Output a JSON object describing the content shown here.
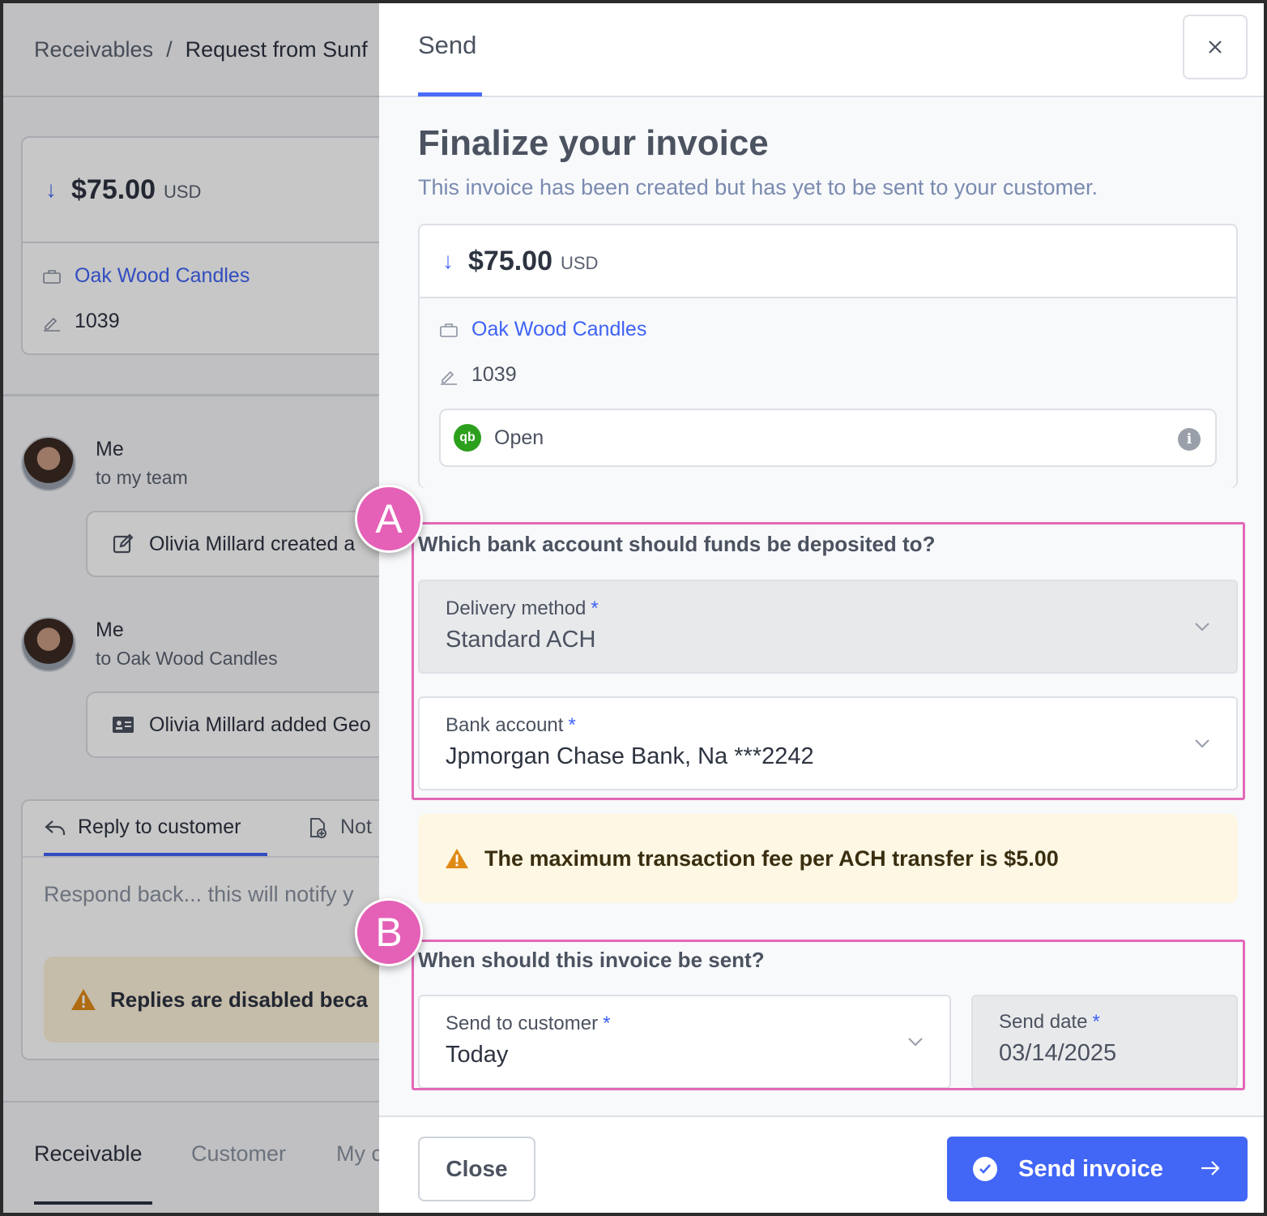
{
  "background": {
    "breadcrumb": {
      "root": "Receivables",
      "separator": "/",
      "current": "Request from Sunf"
    },
    "summary": {
      "amount": "$75.00",
      "currency": "USD",
      "customer": "Oak Wood Candles",
      "invoice_number": "1039"
    },
    "feed": [
      {
        "name": "Me",
        "sub": "to my team",
        "event": "Olivia Millard created a"
      },
      {
        "name": "Me",
        "sub": "to Oak Wood Candles",
        "event": "Olivia Millard added Geo"
      }
    ],
    "reply": {
      "tab_reply": "Reply to customer",
      "tab_note": "Not",
      "placeholder": "Respond back... this will notify y",
      "warning": "Replies are disabled beca"
    },
    "bottom_tabs": [
      "Receivable",
      "Customer",
      "My c"
    ]
  },
  "modal": {
    "tab": "Send",
    "close_icon": "close-icon",
    "title": "Finalize your invoice",
    "subtitle": "This invoice has been created but has yet to be sent to your customer.",
    "invoice": {
      "amount": "$75.00",
      "currency": "USD",
      "customer": "Oak Wood Candles",
      "invoice_number": "1039",
      "sync_logo": "qb",
      "sync_status": "Open",
      "sync_color": "#2ca01c"
    },
    "bank_section": {
      "badge": "A",
      "question": "Which bank account should funds be deposited to?",
      "delivery_label": "Delivery method",
      "delivery_value": "Standard ACH",
      "bank_label": "Bank account",
      "bank_value": "Jpmorgan Chase Bank, Na ***2242",
      "required_mark": "*"
    },
    "fee_warning": "The maximum transaction fee per ACH transfer is $5.00",
    "send_section": {
      "badge": "B",
      "question": "When should this invoice be sent?",
      "send_to_label": "Send to customer",
      "send_to_value": "Today",
      "send_date_label": "Send date",
      "send_date_value": "03/14/2025",
      "required_mark": "*"
    },
    "footer": {
      "close_label": "Close",
      "send_label": "Send invoice"
    }
  },
  "colors": {
    "accent": "#4266f5",
    "highlight": "#e268b8",
    "warning_bg": "#fef7e4"
  }
}
